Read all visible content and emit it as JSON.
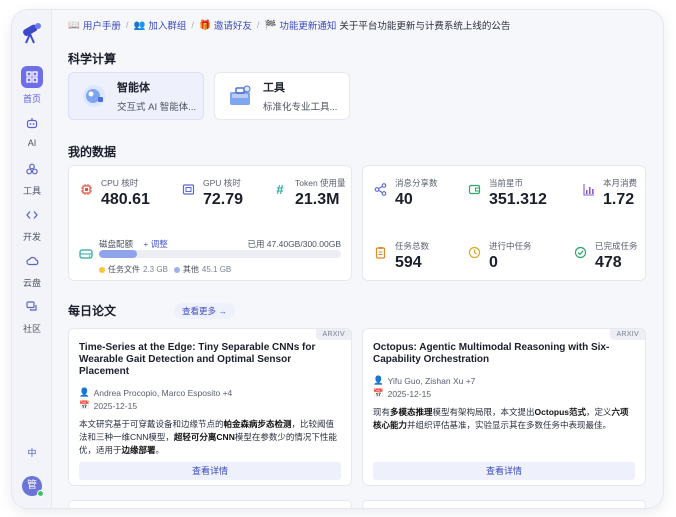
{
  "sidebar": {
    "items": [
      {
        "label": "首页",
        "icon": "home-grid-icon"
      },
      {
        "label": "AI",
        "icon": "robot-icon"
      },
      {
        "label": "工具",
        "icon": "tools-icon"
      },
      {
        "label": "开发",
        "icon": "code-icon"
      },
      {
        "label": "云盘",
        "icon": "cloud-icon"
      },
      {
        "label": "社区",
        "icon": "chat-icon"
      }
    ],
    "lang": "中",
    "avatar": "管"
  },
  "topbar": {
    "handbook": "用户手册",
    "join_group": "加入群组",
    "invite": "邀请好友",
    "notice_label": "功能更新通知",
    "notice_text": "关于平台功能更新与计费系统上线的公告"
  },
  "science": {
    "title": "科学计算",
    "tools": [
      {
        "name": "智能体",
        "desc": "交互式 AI 智能体..."
      },
      {
        "name": "工具",
        "desc": "标准化专业工具..."
      }
    ]
  },
  "my_data": {
    "title": "我的数据",
    "cpu": {
      "label": "CPU 核时",
      "value": "480.61"
    },
    "gpu": {
      "label": "GPU 核时",
      "value": "72.79"
    },
    "token": {
      "label": "Token 使用量",
      "value": "21.3M"
    },
    "disk": {
      "label": "磁盘配额",
      "adjust": "+ 调整",
      "usage": "已用 47.40GB/300.00GB",
      "used_fraction": 0.158,
      "task_files_label": "任务文件",
      "task_files_size": "2.3 GB",
      "other_label": "其他",
      "other_size": "45.1 GB"
    },
    "messages": {
      "label": "消息分享数",
      "value": "40"
    },
    "coins": {
      "label": "当前星币",
      "value": "351.312"
    },
    "month_spend": {
      "label": "本月消费",
      "value": "1.72"
    },
    "tasks_total": {
      "label": "任务总数",
      "value": "594"
    },
    "tasks_running": {
      "label": "进行中任务",
      "value": "0"
    },
    "tasks_done": {
      "label": "已完成任务",
      "value": "478"
    },
    "colors": {
      "task_files": "#f5c542",
      "other": "#9fb0ee"
    }
  },
  "papers": {
    "title": "每日论文",
    "more": "查看更多 →",
    "items": [
      {
        "tag": "ARXIV",
        "title": "Time-Series at the Edge: Tiny Separable CNNs for Wearable Gait Detection and Optimal Sensor Placement",
        "authors": "Andrea Procopio, Marco Esposito +4",
        "date": "2025-12-15",
        "desc_1": "本文研究基于可穿戴设备和边缘节点的",
        "desc_b1": "帕金森病步态检测",
        "desc_2": "，比较阈值法和三种一维CNN模型，",
        "desc_b2": "超轻可分离CNN",
        "desc_3": "模型在参数少的情况下性能优，适用于",
        "desc_b3": "边缘部署",
        "desc_4": "。",
        "detail": "查看详情"
      },
      {
        "tag": "ARXIV",
        "title": "Octopus: Agentic Multimodal Reasoning with Six-Capability Orchestration",
        "authors": "Yifu Guo, Zishan Xu +7",
        "date": "2025-12-15",
        "desc_1": "现有",
        "desc_b1": "多模态推理",
        "desc_2": "模型有架构局限，本文提出",
        "desc_b2": "Octopus范式",
        "desc_3": "，定义",
        "desc_b3": "六项核心能力",
        "desc_4": "并组织评估基准，实验显示其在多数任务中表现最佳。",
        "detail": "查看详情"
      }
    ]
  }
}
